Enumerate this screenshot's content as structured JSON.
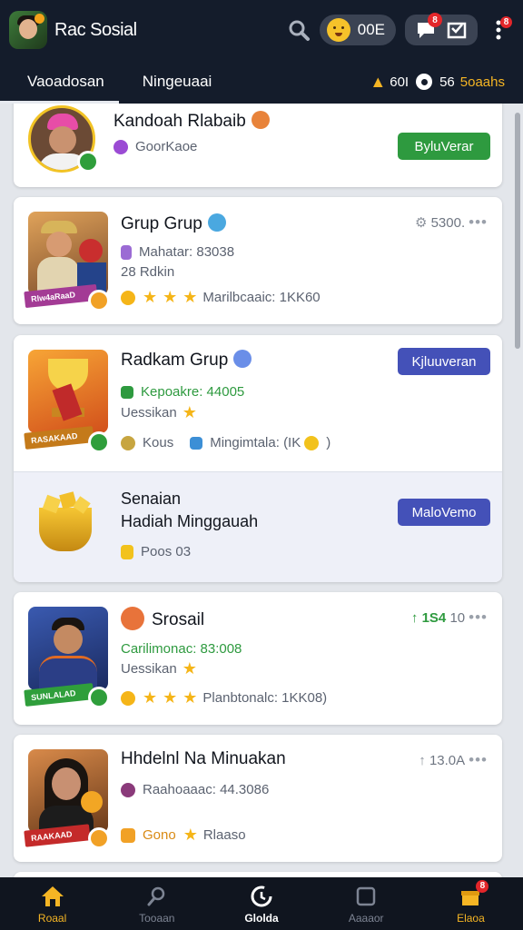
{
  "header": {
    "app_title": "Rac Sosial",
    "coin_count": "00E",
    "message_badge": "8",
    "menu_badge": "8"
  },
  "tabs": [
    {
      "label": "Vaoadosan",
      "active": true
    },
    {
      "label": "Ningeuaai",
      "active": false
    }
  ],
  "tab_stats": {
    "value1": "60I",
    "value2": "56",
    "value2_label": "5oaahs"
  },
  "cards": {
    "c1": {
      "title": "Kandoah Rlabaib",
      "meta1": "GoorKaoe",
      "button": "ByluVerar"
    },
    "c2": {
      "title": "Grup Grup",
      "meta1": "Mahatar: 83038",
      "meta2": "28 Rdkin",
      "meta3": "Marilbcaaic: 1KK60",
      "right_stat": "5300.",
      "ribbon": "Rlw4aRaaD"
    },
    "c3": {
      "title": "Radkam Grup",
      "meta1": "Kepoakre: 44005",
      "meta2": "Uessikan",
      "meta3a": "Kous",
      "meta3b": "Mingimtala: (IK",
      "button": "Kjluuveran",
      "ribbon": "RASAKAAD"
    },
    "c3b": {
      "line1": "Senaian",
      "line2": "Hadiah Minggauah",
      "meta": "Poos 03",
      "button": "MaloVemo"
    },
    "c4": {
      "title": "Srosail",
      "meta1": "Carilimonac: 83:008",
      "meta2": "Uessikan",
      "meta3": "Planbtonalc: 1KK08)",
      "right_gain": "1S4",
      "right_stat": "10",
      "ribbon": "SUNLALAD"
    },
    "c5": {
      "title": "Hhdelnl Na Minuakan",
      "meta1": "Raahoaaac: 44.3086",
      "meta2a": "Gono",
      "meta2b": "Rlaaso",
      "right_stat": "13.0A",
      "ribbon": "RAAKAAD"
    }
  },
  "nav": [
    {
      "label": "Roaal",
      "icon": "home-icon"
    },
    {
      "label": "Tooaan",
      "icon": "search-icon"
    },
    {
      "label": "Glolda",
      "icon": "refresh-icon"
    },
    {
      "label": "Aaaaor",
      "icon": "square-icon"
    },
    {
      "label": "Elaoa",
      "icon": "gift-icon",
      "badge": "8"
    }
  ],
  "colors": {
    "accent_green": "#2e9a3f",
    "accent_blue": "#4451b8",
    "gold": "#f5b524",
    "header_bg": "#141c2b"
  }
}
